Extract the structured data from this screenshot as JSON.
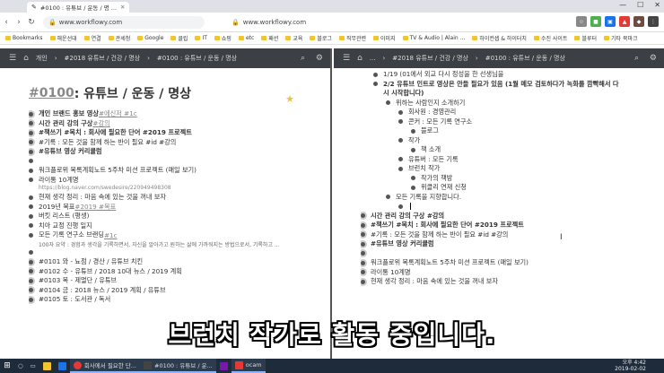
{
  "browser": {
    "tab_title": "#0100 : 유튜브 / 운동 / 명 ...",
    "url_left": "www.workflowy.com",
    "url_right": "www.workflowy.com"
  },
  "bookmarks": [
    "Bookmarks",
    "해운선대",
    "연결",
    "관세청",
    "Google",
    "클립",
    "IT",
    "쇼핑",
    "etc",
    "패션",
    "교육",
    "블로그",
    "직무관련",
    "이미지",
    "TV & Audio | Alain ...",
    "하이컨셉 & 하이터치",
    "수진 사이트",
    "블루터",
    "기타 북마크"
  ],
  "left": {
    "breadcrumb": [
      "개인",
      "#2018 유튜브 / 건강 / 명상",
      "#0100 : 유튜브 / 운동 / 명상"
    ],
    "title_tag": "#0100",
    "title_rest": " : 유튜브 / 운동 / 명상",
    "items": [
      {
        "text": "개인 브랜드 홍보 영상 ",
        "tag": "#에신저 #1c",
        "bold": true
      },
      {
        "text": "시간 관리 강의 구상 ",
        "tag": "#강의",
        "bold": true
      },
      {
        "text": "#책쓰기 #목치 : 회사에 필요한 단어 #2019 프로젝트",
        "tag": "",
        "bold": true
      },
      {
        "text": "#기록 : 모든 것을 함께 하는 반이 필요 #id #강의",
        "tag": "",
        "bold": false
      },
      {
        "text": "#유튜브 영상 커리큘럼",
        "tag": "",
        "bold": true
      },
      {
        "text": "",
        "tag": "",
        "bold": false
      },
      {
        "text": "워크플로위 목록계획노트 5주차 미션 프로젝트 (매일 보기)",
        "tag": "",
        "bold": false
      },
      {
        "text": "라이통 10계명",
        "tag": "",
        "bold": false
      },
      {
        "text": "현재 생각 정리 : 마음 속에 있는 것을 꺼내 보자",
        "tag": "",
        "bold": false
      },
      {
        "text": "2019년 목표 ",
        "tag": "#2019 #목표",
        "bold": false
      },
      {
        "text": "버킷 리스트 (평생)",
        "tag": "",
        "bold": false
      },
      {
        "text": "치아 교정 진행 일지",
        "tag": "",
        "bold": false
      },
      {
        "text": "모든 기록 연구소 브랜딩 ",
        "tag": "#1c",
        "bold": false
      },
      {
        "text": "",
        "tag": "",
        "bold": false
      },
      {
        "text": "#0101 와 - 뇨점 / 경산 / 유튜브 치킨",
        "tag": "",
        "bold": false
      },
      {
        "text": "#0102 수 - 유튜브 / 2018 10대 뉴스 / 2019 계획",
        "tag": "",
        "bold": false
      },
      {
        "text": "#0103 목 - 제멀단 / 유튜브",
        "tag": "",
        "bold": false
      },
      {
        "text": "#0104 금 : 2018 뉴스 / 2019 계획 / 유튜브",
        "tag": "",
        "bold": false
      },
      {
        "text": "#0105 토 : 도서관 / 독서",
        "tag": "",
        "bold": false
      }
    ],
    "link": "https://blog.naver.com/swedesire/220949498308",
    "sub_note": "100자 요약 : 경험과 생각을 기록하면서, 자신을 알아가고 원하는 삶에 가까워지는 방법으로서, 기록하고 ..."
  },
  "right": {
    "breadcrumb": [
      "...",
      "#2018 유튜브 / 건강 / 명상",
      "#0100 : 유튜브 / 운동 / 명상"
    ],
    "items": [
      {
        "lvl": 2,
        "text": "1/19 (01에서 외교 다시 정성을 한 선생님을",
        "bold": false
      },
      {
        "lvl": 2,
        "text": "2/2 유튜브 인트로 영상은 안들 필요가 있음 (1월 메모 검토하다가 녹화를 깜빡해서 다",
        "bold": true
      },
      {
        "lvl": 2,
        "text": "시 시작합니다)",
        "bold": true,
        "nob": true
      },
      {
        "lvl": 3,
        "text": "위하는 사람인지 소개하기",
        "bold": false
      },
      {
        "lvl": 4,
        "text": "회사원 : 경영관리",
        "bold": false
      },
      {
        "lvl": 4,
        "text": "콘커 : 모든 기록 연구소",
        "bold": false
      },
      {
        "lvl": 5,
        "text": "블로그",
        "bold": false
      },
      {
        "lvl": 4,
        "text": "작가",
        "bold": false
      },
      {
        "lvl": 5,
        "text": "책 소개",
        "bold": false
      },
      {
        "lvl": 4,
        "text": "유튜버 : 모든 기록",
        "bold": false
      },
      {
        "lvl": 4,
        "text": "브런치 작가",
        "bold": false
      },
      {
        "lvl": 5,
        "text": "작가의 책방",
        "bold": false
      },
      {
        "lvl": 5,
        "text": "위클리 연재 신청",
        "bold": false
      },
      {
        "lvl": 3,
        "text": "모든 기록을 지향합니다.",
        "bold": false
      },
      {
        "lvl": 4,
        "text": "",
        "bold": false,
        "cursor": true
      },
      {
        "lvl": 1,
        "text": "시간 관리 강의 구상 #강의",
        "bold": true
      },
      {
        "lvl": 1,
        "text": "#책쓰기 #목치 : 회사에 필요한 단어 #2019 프로젝트",
        "bold": true
      },
      {
        "lvl": 1,
        "text": "#기록 : 모든 것을 함께 하는 반이 필요 #id #강의",
        "bold": false
      },
      {
        "lvl": 1,
        "text": "#유튜브 영상 커리큘럼",
        "bold": true
      },
      {
        "lvl": 1,
        "text": "",
        "bold": false
      },
      {
        "lvl": 1,
        "text": "워크플로위 목록계획노트 5주차 미션 프로젝트 (매일 보기)",
        "bold": false
      },
      {
        "lvl": 1,
        "text": "라이통 10계명",
        "bold": false
      },
      {
        "lvl": 1,
        "text": "현재 생각 정리 : 마음 속에 있는 것을 꺼내 보자",
        "bold": false
      }
    ]
  },
  "subtitle": "브런치 작가로 활동 중입니다.",
  "taskbar": {
    "items": [
      "회사에서 필요한 단...",
      "#0100 : 유튜브 / 운...",
      "ocam"
    ],
    "time": "오후 4:42",
    "date": "2019-02-02"
  },
  "colors": {
    "header": "#3c3f44",
    "taskbar": "#1e2b3a",
    "star": "#f0c040"
  }
}
